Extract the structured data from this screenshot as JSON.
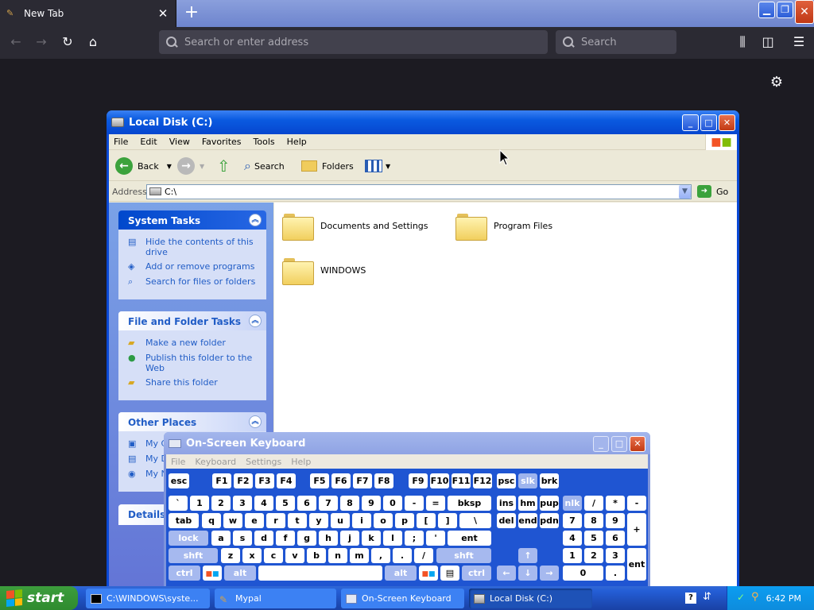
{
  "browser": {
    "tab_title": "New Tab",
    "new_tab_symbol": "+",
    "close_symbol": "✕",
    "url_placeholder": "Search or enter address",
    "search_placeholder": "Search"
  },
  "explorer": {
    "title": "Local Disk (C:)",
    "menu": [
      "File",
      "Edit",
      "View",
      "Favorites",
      "Tools",
      "Help"
    ],
    "toolbar": {
      "back": "Back",
      "search": "Search",
      "folders": "Folders"
    },
    "address_label": "Address",
    "address_value": "C:\\",
    "go_label": "Go",
    "system_tasks": {
      "title": "System Tasks",
      "items": [
        "Hide the contents of this drive",
        "Add or remove programs",
        "Search for files or folders"
      ]
    },
    "file_folder_tasks": {
      "title": "File and Folder Tasks",
      "items": [
        "Make a new folder",
        "Publish this folder to the Web",
        "Share this folder"
      ]
    },
    "other_places": {
      "title": "Other Places",
      "items": [
        "My C",
        "My D",
        "My N"
      ]
    },
    "details_title": "Details",
    "folders": [
      "Documents and Settings",
      "Program Files",
      "WINDOWS"
    ]
  },
  "osk": {
    "title": "On-Screen Keyboard",
    "menu": [
      "File",
      "Keyboard",
      "Settings",
      "Help"
    ],
    "keys": {
      "esc": "esc",
      "f1": "F1",
      "f2": "F2",
      "f3": "F3",
      "f4": "F4",
      "f5": "F5",
      "f6": "F6",
      "f7": "F7",
      "f8": "F8",
      "f9": "F9",
      "f10": "F10",
      "f11": "F11",
      "f12": "F12",
      "psc": "psc",
      "slk": "slk",
      "brk": "brk",
      "r1": [
        "`",
        "1",
        "2",
        "3",
        "4",
        "5",
        "6",
        "7",
        "8",
        "9",
        "0",
        "-",
        "="
      ],
      "bksp": "bksp",
      "ins": "ins",
      "hm": "hm",
      "pup": "pup",
      "nlk": "nlk",
      "np_div": "/",
      "np_mul": "*",
      "np_sub": "-",
      "tab": "tab",
      "r2": [
        "q",
        "w",
        "e",
        "r",
        "t",
        "y",
        "u",
        "i",
        "o",
        "p",
        "[",
        "]",
        "\\"
      ],
      "del": "del",
      "end": "end",
      "pdn": "pdn",
      "np7": "7",
      "np8": "8",
      "np9": "9",
      "np_add": "+",
      "lock": "lock",
      "r3": [
        "a",
        "s",
        "d",
        "f",
        "g",
        "h",
        "j",
        "k",
        "l",
        ";",
        "'"
      ],
      "ent": "ent",
      "np4": "4",
      "np5": "5",
      "np6": "6",
      "shft": "shft",
      "r4": [
        "z",
        "x",
        "c",
        "v",
        "b",
        "n",
        "m",
        ",",
        ".",
        "/"
      ],
      "up": "↑",
      "np1": "1",
      "np2": "2",
      "np3": "3",
      "np_ent": "ent",
      "ctrl": "ctrl",
      "alt": "alt",
      "left": "←",
      "down": "↓",
      "right": "→",
      "np0": "0",
      "np_dot": "."
    }
  },
  "taskbar": {
    "start": "start",
    "tasks": [
      "C:\\WINDOWS\\syste...",
      "Mypal",
      "On-Screen Keyboard",
      "Local Disk (C:)"
    ],
    "clock": "6:42 PM"
  }
}
